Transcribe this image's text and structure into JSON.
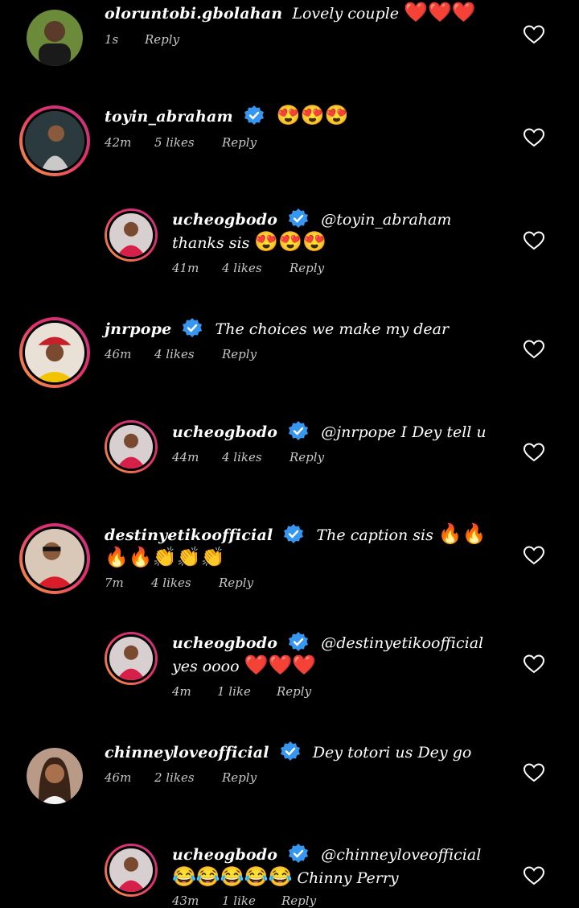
{
  "comments": [
    {
      "username": "oloruntobi.gbolahan",
      "verified": false,
      "text": "Lovely couple",
      "emoji": "❤️❤️❤️",
      "time": "1s",
      "likes": "",
      "reply": "Reply"
    },
    {
      "username": "toyin_abraham",
      "verified": true,
      "text": "",
      "emoji": "😍😍😍",
      "time": "42m",
      "likes": "5 likes",
      "reply": "Reply"
    },
    {
      "username": "ucheogbodo",
      "verified": true,
      "text": "@toyin_abraham thanks sis",
      "emoji": "😍😍😍",
      "time": "41m",
      "likes": "4 likes",
      "reply": "Reply"
    },
    {
      "username": "jnrpope",
      "verified": true,
      "text": "The choices we make my dear",
      "emoji": "",
      "time": "46m",
      "likes": "4 likes",
      "reply": "Reply"
    },
    {
      "username": "ucheogbodo",
      "verified": true,
      "text": "@jnrpope I Dey tell u",
      "emoji": "",
      "time": "44m",
      "likes": "4 likes",
      "reply": "Reply"
    },
    {
      "username": "destinyetikoofficial",
      "verified": true,
      "text": "The caption sis",
      "emoji": "🔥🔥🔥🔥👏👏👏",
      "time": "7m",
      "likes": "4 likes",
      "reply": "Reply"
    },
    {
      "username": "ucheogbodo",
      "verified": true,
      "text": "@destinyetikoofficial yes oooo",
      "emoji": "❤️❤️❤️",
      "time": "4m",
      "likes": "1 like",
      "reply": "Reply"
    },
    {
      "username": "chinneyloveofficial",
      "verified": true,
      "text": "Dey totori us Dey go",
      "emoji": "",
      "time": "46m",
      "likes": "2 likes",
      "reply": "Reply"
    },
    {
      "username": "ucheogbodo",
      "verified": true,
      "text": "@chinneyloveofficial",
      "emoji": "😂😂😂😂😂",
      "text2": "Chinny Perry",
      "time": "43m",
      "likes": "1 like",
      "reply": "Reply"
    }
  ],
  "colors": {
    "background": "#000000",
    "meta": "#c7c7c7",
    "verified": "#3797f0",
    "ring_start": "#f9a03f",
    "ring_end": "#c13584"
  },
  "icons": {
    "like": "heart-outline-icon",
    "verified": "verified-badge-icon"
  }
}
